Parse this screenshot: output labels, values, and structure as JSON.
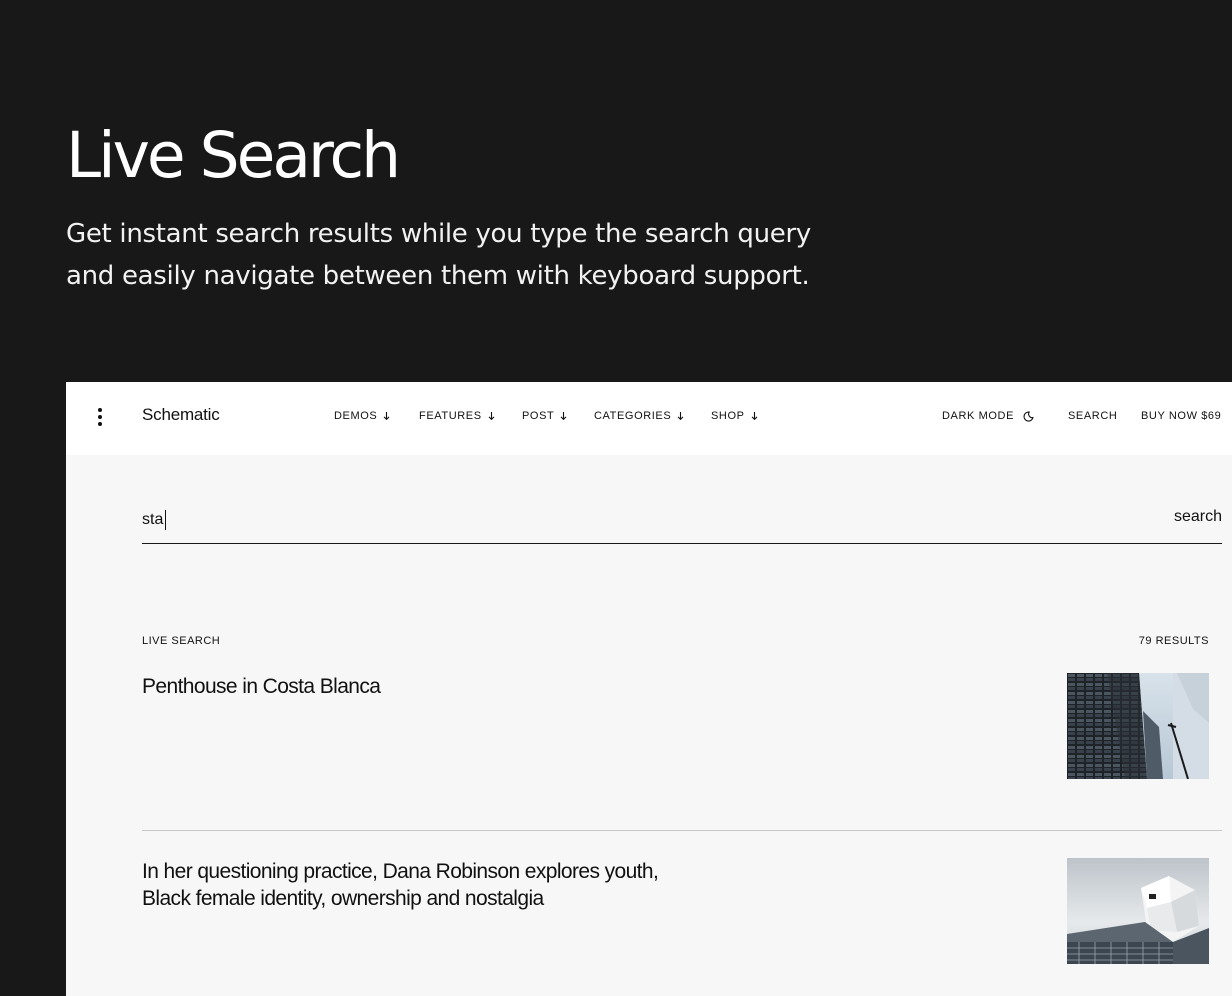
{
  "hero": {
    "title": "Live Search",
    "subtitle_line1": "Get instant search results while you type the search query",
    "subtitle_line2": "and easily navigate between them with keyboard support."
  },
  "header": {
    "brand": "Schematic",
    "nav": [
      {
        "label": "DEMOS",
        "icon": "arrow-down-icon"
      },
      {
        "label": "FEATURES",
        "icon": "arrow-down-icon"
      },
      {
        "label": "POST",
        "icon": "arrow-down-icon"
      },
      {
        "label": "CATEGORIES",
        "icon": "arrow-down-icon"
      },
      {
        "label": "SHOP",
        "icon": "arrow-down-icon"
      }
    ],
    "dark_mode_label": "DARK MODE",
    "dark_mode_icon": "moon-icon",
    "search_label": "SEARCH",
    "buy_label": "BUY NOW $69",
    "menu_icon": "vertical-dots-icon"
  },
  "search": {
    "value": "sta",
    "submit_label": "search"
  },
  "results": {
    "label": "LIVE SEARCH",
    "count_label": "79 RESULTS",
    "items": [
      {
        "title": "Penthouse in Costa Blanca",
        "thumbnail": "dark-building-facade-photo"
      },
      {
        "title": "In her questioning practice, Dana Robinson explores youth, Black female identity, ownership and nostalgia",
        "thumbnail": "white-building-sky-photo"
      }
    ]
  },
  "colors": {
    "page_background": "#181818",
    "panel_background": "#f7f7f7",
    "header_background": "#ffffff",
    "text_dark": "#111111",
    "text_light": "#ffffff"
  }
}
